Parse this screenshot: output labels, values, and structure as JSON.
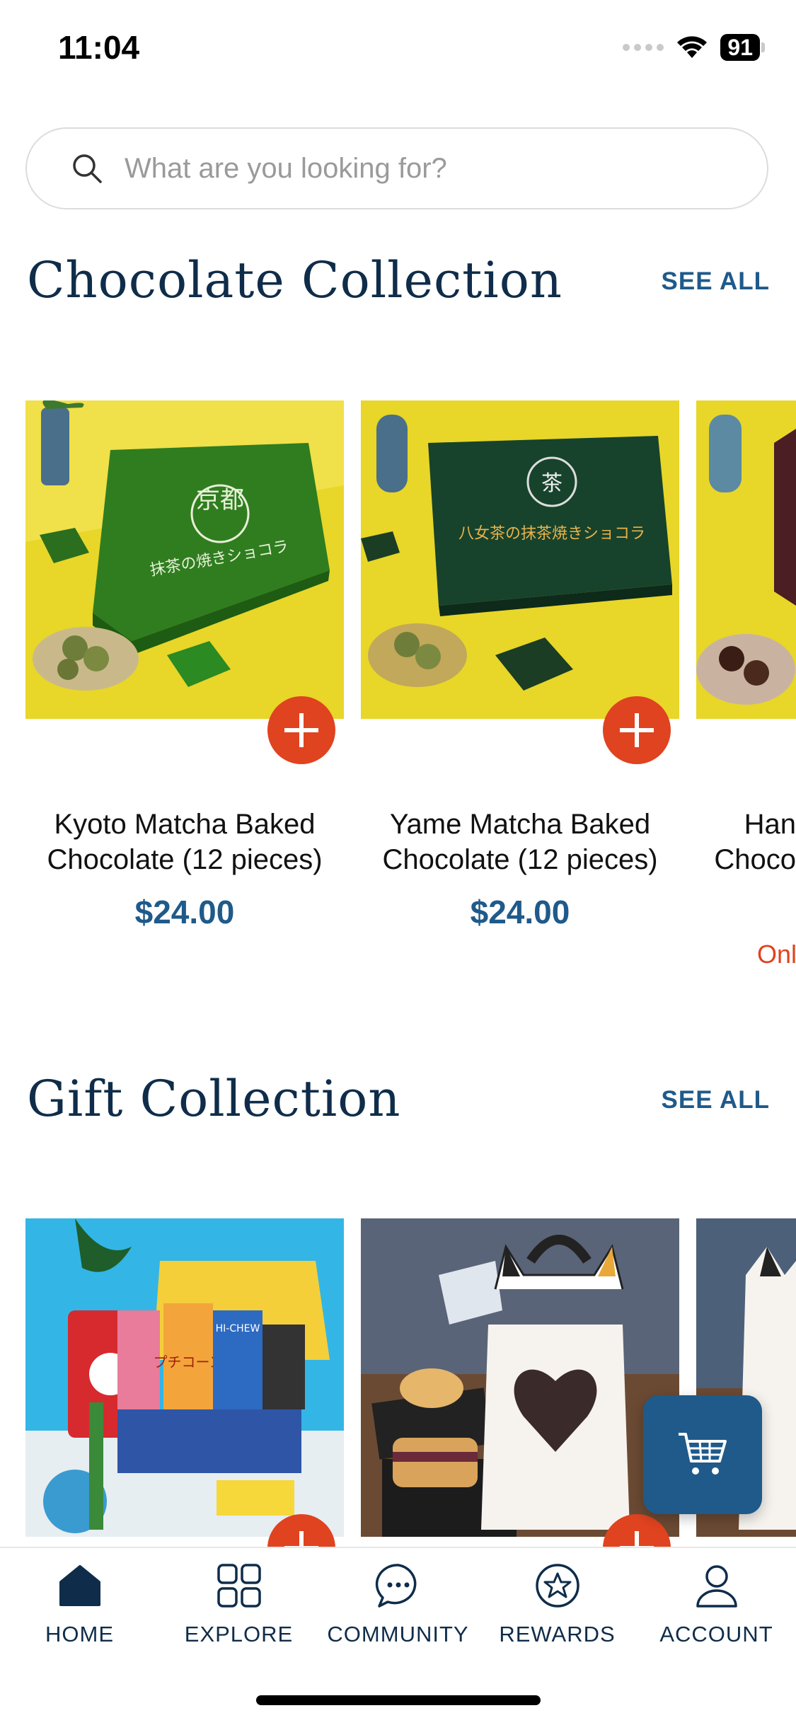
{
  "status_bar": {
    "time": "11:04",
    "battery": "91"
  },
  "search": {
    "placeholder": "What are you looking for?"
  },
  "sections": {
    "chocolate": {
      "title": "Chocolate Collection",
      "see_all": "SEE ALL",
      "products": [
        {
          "name": "Kyoto Matcha Baked Chocolate (12 pieces)",
          "price": "$24.00",
          "box_text": "抹茶の焼きショコラ",
          "box_mark": "京都",
          "image": "green-matcha-chocolate-box"
        },
        {
          "name": "Yame Matcha Baked Chocolate (12 pieces)",
          "price": "$24.00",
          "box_text": "八女茶の抹茶焼きショコラ",
          "box_mark": "茶",
          "image": "dark-green-matcha-chocolate-box"
        },
        {
          "name_partial": "Han\nChoco",
          "note_partial": "Only",
          "image": "dark-chocolate-box-partial"
        }
      ]
    },
    "gift": {
      "title": "Gift Collection",
      "see_all": "SEE ALL",
      "products": [
        {
          "image": "japanese-snack-gift-box",
          "pack_label_1": "プチコーン",
          "pack_label_2": "HI-CHEW"
        },
        {
          "image": "cat-cake-gift-box"
        },
        {
          "image": "cat-gift-box-partial"
        }
      ]
    }
  },
  "tabs": [
    {
      "label": "HOME",
      "icon": "home-icon",
      "active": true
    },
    {
      "label": "EXPLORE",
      "icon": "grid-icon",
      "active": false
    },
    {
      "label": "COMMUNITY",
      "icon": "chat-bubble-icon",
      "active": false
    },
    {
      "label": "REWARDS",
      "icon": "star-badge-icon",
      "active": false
    },
    {
      "label": "ACCOUNT",
      "icon": "person-icon",
      "active": false
    }
  ],
  "colors": {
    "accent": "#e0431f",
    "brand_blue": "#1f5a8a",
    "navy": "#0f2d4a"
  }
}
